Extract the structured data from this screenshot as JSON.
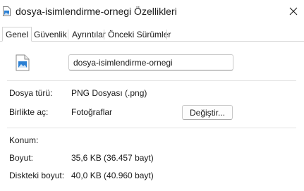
{
  "window": {
    "title": "dosya-isimlendirme-ornegi Özellikleri",
    "close_icon": "close-icon",
    "title_icon": "image-file-icon"
  },
  "tabs": [
    {
      "label": "Genel",
      "active": true
    },
    {
      "label": "Güvenlik",
      "active": false
    },
    {
      "label": "Ayrıntılar",
      "active": false
    },
    {
      "label": "Önceki Sürümler",
      "active": false
    }
  ],
  "general": {
    "file_icon": "image-file-icon",
    "file_name": "dosya-isimlendirme-ornegi",
    "file_type_label": "Dosya türü:",
    "file_type_value": "PNG Dosyası (.png)",
    "opens_with_label": "Birlikte aç:",
    "opens_with_value": "Fotoğraflar",
    "change_button_label": "Değiştir...",
    "location_label": "Konum:",
    "location_value": "",
    "size_label": "Boyut:",
    "size_value": "35,6 KB (36.457 bayt)",
    "size_on_disk_label": "Diskteki boyut:",
    "size_on_disk_value": "40,0 KB (40.960 bayt)"
  },
  "colors": {
    "accent": "#1e72c8",
    "icon_blue": "#2a7fd3",
    "divider": "#e3e3e3"
  }
}
